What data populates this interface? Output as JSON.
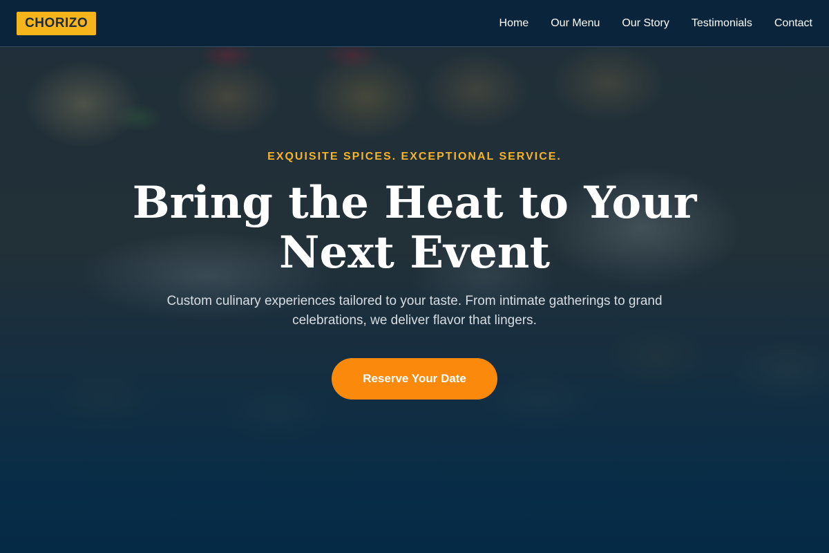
{
  "brand": {
    "logo_text": "CHORIZO"
  },
  "nav": {
    "items": [
      {
        "label": "Home"
      },
      {
        "label": "Our Menu"
      },
      {
        "label": "Our Story"
      },
      {
        "label": "Testimonials"
      },
      {
        "label": "Contact"
      }
    ]
  },
  "hero": {
    "tagline": "EXQUISITE SPICES. EXCEPTIONAL SERVICE.",
    "headline": "Bring the Heat to Your Next Event",
    "subtitle": "Custom culinary experiences tailored to your taste. From intimate gatherings to grand celebrations, we deliver flavor that lingers.",
    "cta_label": "Reserve Your Date"
  },
  "colors": {
    "logo_bg": "#f7b51c",
    "accent": "#f5b428",
    "cta_bg": "#fb8a0c",
    "nav_bg": "#08243c",
    "overlay": "#0a2640"
  }
}
